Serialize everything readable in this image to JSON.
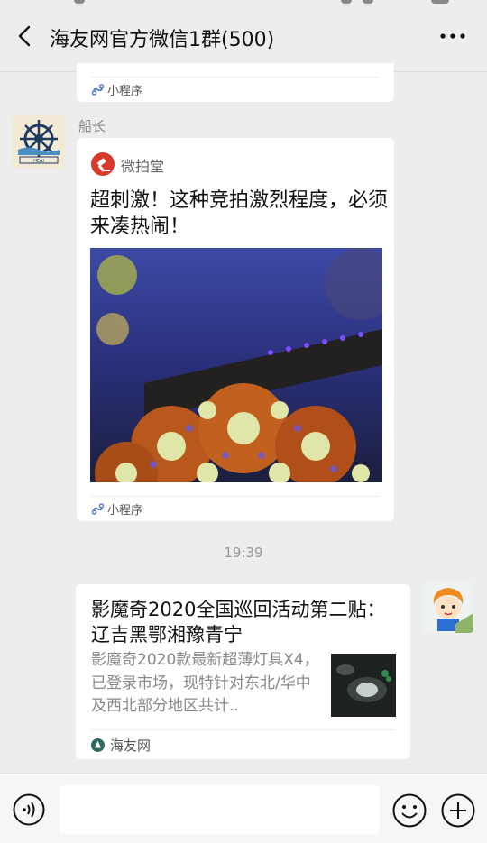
{
  "header": {
    "title": "海友网官方微信1群(500)"
  },
  "messages": {
    "prev_card": {
      "mini_program_label": "小程序"
    },
    "captain_card": {
      "sender": "船长",
      "source_name": "微拍堂",
      "title": "超刺激！这种竞拍激烈程度，必须来凑热闹！",
      "mini_program_label": "小程序"
    },
    "timestamp": "19:39",
    "link_card": {
      "title": "影魔奇2020全国巡回活动第二贴： 辽吉黑鄂湘豫青宁",
      "description": "影魔奇2020款最新超薄灯具X4，已登录市场，现特针对东北/华中及西北部分地区共计..",
      "source_name": "海友网"
    }
  },
  "input_bar": {
    "placeholder": ""
  },
  "colors": {
    "background": "#ededed",
    "card": "#ffffff",
    "source_red": "#d63a2a",
    "source_teal": "#2d6b62"
  },
  "icons": [
    "back-icon",
    "more-icon",
    "mini-program-icon",
    "voice-icon",
    "emoji-icon",
    "plus-icon"
  ]
}
